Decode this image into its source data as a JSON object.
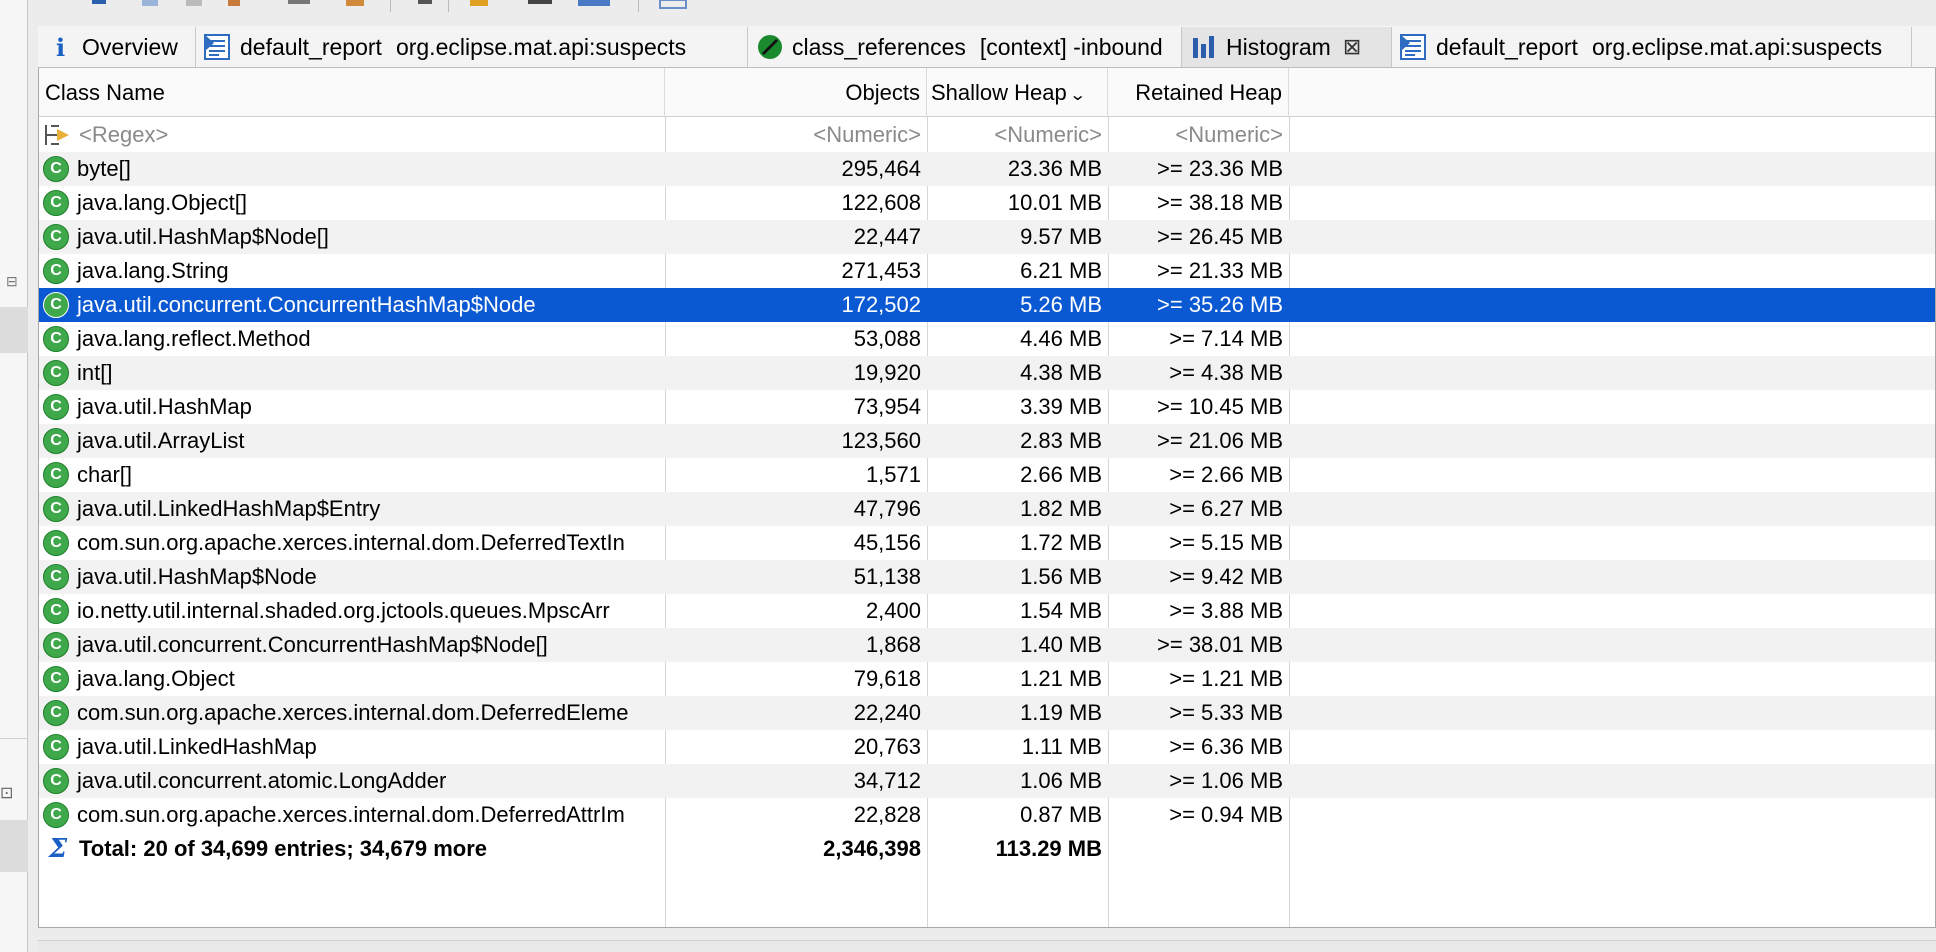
{
  "tabs": [
    {
      "title": "Overview",
      "icon": "info-icon",
      "active": false
    },
    {
      "title": "default_report",
      "subtitle": "org.eclipse.mat.api:suspects",
      "icon": "report-icon",
      "active": false
    },
    {
      "title": "class_references",
      "subtitle": "[context] -inbound",
      "icon": "query-icon",
      "active": false
    },
    {
      "title": "Histogram",
      "icon": "histogram-icon",
      "active": true,
      "close_glyph": "⊠"
    },
    {
      "title": "default_report",
      "subtitle": "org.eclipse.mat.api:suspects",
      "icon": "report-icon",
      "active": false
    }
  ],
  "columns": {
    "class_name": "Class Name",
    "objects": "Objects",
    "shallow_heap": "Shallow Heap",
    "retained_heap": "Retained Heap",
    "sort_glyph": "⌄"
  },
  "filter_row": {
    "name": "<Regex>",
    "objects": "<Numeric>",
    "shallow": "<Numeric>",
    "retained": "<Numeric>"
  },
  "rows": [
    {
      "name": "byte[]",
      "objects": "295,464",
      "shallow": "23.36 MB",
      "retained": ">= 23.36 MB"
    },
    {
      "name": "java.lang.Object[]",
      "objects": "122,608",
      "shallow": "10.01 MB",
      "retained": ">= 38.18 MB"
    },
    {
      "name": "java.util.HashMap$Node[]",
      "objects": "22,447",
      "shallow": "9.57 MB",
      "retained": ">= 26.45 MB"
    },
    {
      "name": "java.lang.String",
      "objects": "271,453",
      "shallow": "6.21 MB",
      "retained": ">= 21.33 MB"
    },
    {
      "name": "java.util.concurrent.ConcurrentHashMap$Node",
      "objects": "172,502",
      "shallow": "5.26 MB",
      "retained": ">= 35.26 MB",
      "selected": true
    },
    {
      "name": "java.lang.reflect.Method",
      "objects": "53,088",
      "shallow": "4.46 MB",
      "retained": ">= 7.14 MB"
    },
    {
      "name": "int[]",
      "objects": "19,920",
      "shallow": "4.38 MB",
      "retained": ">= 4.38 MB"
    },
    {
      "name": "java.util.HashMap",
      "objects": "73,954",
      "shallow": "3.39 MB",
      "retained": ">= 10.45 MB"
    },
    {
      "name": "java.util.ArrayList",
      "objects": "123,560",
      "shallow": "2.83 MB",
      "retained": ">= 21.06 MB"
    },
    {
      "name": "char[]",
      "objects": "1,571",
      "shallow": "2.66 MB",
      "retained": ">= 2.66 MB"
    },
    {
      "name": "java.util.LinkedHashMap$Entry",
      "objects": "47,796",
      "shallow": "1.82 MB",
      "retained": ">= 6.27 MB"
    },
    {
      "name": "com.sun.org.apache.xerces.internal.dom.DeferredTextIn",
      "objects": "45,156",
      "shallow": "1.72 MB",
      "retained": ">= 5.15 MB"
    },
    {
      "name": "java.util.HashMap$Node",
      "objects": "51,138",
      "shallow": "1.56 MB",
      "retained": ">= 9.42 MB"
    },
    {
      "name": "io.netty.util.internal.shaded.org.jctools.queues.MpscArr",
      "objects": "2,400",
      "shallow": "1.54 MB",
      "retained": ">= 3.88 MB"
    },
    {
      "name": "java.util.concurrent.ConcurrentHashMap$Node[]",
      "objects": "1,868",
      "shallow": "1.40 MB",
      "retained": ">= 38.01 MB"
    },
    {
      "name": "java.lang.Object",
      "objects": "79,618",
      "shallow": "1.21 MB",
      "retained": ">= 1.21 MB"
    },
    {
      "name": "com.sun.org.apache.xerces.internal.dom.DeferredEleme",
      "objects": "22,240",
      "shallow": "1.19 MB",
      "retained": ">= 5.33 MB"
    },
    {
      "name": "java.util.LinkedHashMap",
      "objects": "20,763",
      "shallow": "1.11 MB",
      "retained": ">= 6.36 MB"
    },
    {
      "name": "java.util.concurrent.atomic.LongAdder",
      "objects": "34,712",
      "shallow": "1.06 MB",
      "retained": ">= 1.06 MB"
    },
    {
      "name": "com.sun.org.apache.xerces.internal.dom.DeferredAttrIm",
      "objects": "22,828",
      "shallow": "0.87 MB",
      "retained": ">= 0.94 MB"
    }
  ],
  "total_row": {
    "name": "Total: 20 of 34,699 entries; 34,679 more",
    "objects": "2,346,398",
    "shallow": "113.29 MB",
    "retained": ""
  },
  "class_icon_letter": "C",
  "colors": {
    "selection": "#0a59d3",
    "class_icon": "#3ea84a",
    "row_alt": "#f2f2f2"
  }
}
